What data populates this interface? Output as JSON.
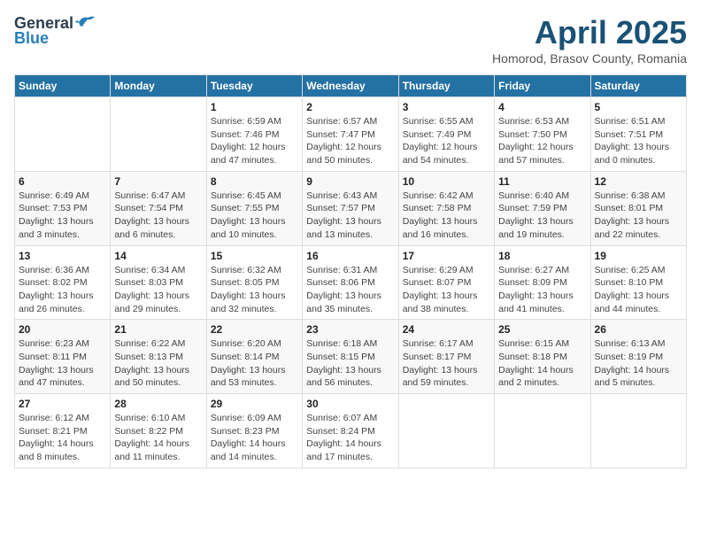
{
  "header": {
    "logo_general": "General",
    "logo_blue": "Blue",
    "month_title": "April 2025",
    "location": "Homorod, Brasov County, Romania"
  },
  "weekdays": [
    "Sunday",
    "Monday",
    "Tuesday",
    "Wednesday",
    "Thursday",
    "Friday",
    "Saturday"
  ],
  "weeks": [
    [
      {
        "day": "",
        "info": ""
      },
      {
        "day": "",
        "info": ""
      },
      {
        "day": "1",
        "info": "Sunrise: 6:59 AM\nSunset: 7:46 PM\nDaylight: 12 hours and 47 minutes."
      },
      {
        "day": "2",
        "info": "Sunrise: 6:57 AM\nSunset: 7:47 PM\nDaylight: 12 hours and 50 minutes."
      },
      {
        "day": "3",
        "info": "Sunrise: 6:55 AM\nSunset: 7:49 PM\nDaylight: 12 hours and 54 minutes."
      },
      {
        "day": "4",
        "info": "Sunrise: 6:53 AM\nSunset: 7:50 PM\nDaylight: 12 hours and 57 minutes."
      },
      {
        "day": "5",
        "info": "Sunrise: 6:51 AM\nSunset: 7:51 PM\nDaylight: 13 hours and 0 minutes."
      }
    ],
    [
      {
        "day": "6",
        "info": "Sunrise: 6:49 AM\nSunset: 7:53 PM\nDaylight: 13 hours and 3 minutes."
      },
      {
        "day": "7",
        "info": "Sunrise: 6:47 AM\nSunset: 7:54 PM\nDaylight: 13 hours and 6 minutes."
      },
      {
        "day": "8",
        "info": "Sunrise: 6:45 AM\nSunset: 7:55 PM\nDaylight: 13 hours and 10 minutes."
      },
      {
        "day": "9",
        "info": "Sunrise: 6:43 AM\nSunset: 7:57 PM\nDaylight: 13 hours and 13 minutes."
      },
      {
        "day": "10",
        "info": "Sunrise: 6:42 AM\nSunset: 7:58 PM\nDaylight: 13 hours and 16 minutes."
      },
      {
        "day": "11",
        "info": "Sunrise: 6:40 AM\nSunset: 7:59 PM\nDaylight: 13 hours and 19 minutes."
      },
      {
        "day": "12",
        "info": "Sunrise: 6:38 AM\nSunset: 8:01 PM\nDaylight: 13 hours and 22 minutes."
      }
    ],
    [
      {
        "day": "13",
        "info": "Sunrise: 6:36 AM\nSunset: 8:02 PM\nDaylight: 13 hours and 26 minutes."
      },
      {
        "day": "14",
        "info": "Sunrise: 6:34 AM\nSunset: 8:03 PM\nDaylight: 13 hours and 29 minutes."
      },
      {
        "day": "15",
        "info": "Sunrise: 6:32 AM\nSunset: 8:05 PM\nDaylight: 13 hours and 32 minutes."
      },
      {
        "day": "16",
        "info": "Sunrise: 6:31 AM\nSunset: 8:06 PM\nDaylight: 13 hours and 35 minutes."
      },
      {
        "day": "17",
        "info": "Sunrise: 6:29 AM\nSunset: 8:07 PM\nDaylight: 13 hours and 38 minutes."
      },
      {
        "day": "18",
        "info": "Sunrise: 6:27 AM\nSunset: 8:09 PM\nDaylight: 13 hours and 41 minutes."
      },
      {
        "day": "19",
        "info": "Sunrise: 6:25 AM\nSunset: 8:10 PM\nDaylight: 13 hours and 44 minutes."
      }
    ],
    [
      {
        "day": "20",
        "info": "Sunrise: 6:23 AM\nSunset: 8:11 PM\nDaylight: 13 hours and 47 minutes."
      },
      {
        "day": "21",
        "info": "Sunrise: 6:22 AM\nSunset: 8:13 PM\nDaylight: 13 hours and 50 minutes."
      },
      {
        "day": "22",
        "info": "Sunrise: 6:20 AM\nSunset: 8:14 PM\nDaylight: 13 hours and 53 minutes."
      },
      {
        "day": "23",
        "info": "Sunrise: 6:18 AM\nSunset: 8:15 PM\nDaylight: 13 hours and 56 minutes."
      },
      {
        "day": "24",
        "info": "Sunrise: 6:17 AM\nSunset: 8:17 PM\nDaylight: 13 hours and 59 minutes."
      },
      {
        "day": "25",
        "info": "Sunrise: 6:15 AM\nSunset: 8:18 PM\nDaylight: 14 hours and 2 minutes."
      },
      {
        "day": "26",
        "info": "Sunrise: 6:13 AM\nSunset: 8:19 PM\nDaylight: 14 hours and 5 minutes."
      }
    ],
    [
      {
        "day": "27",
        "info": "Sunrise: 6:12 AM\nSunset: 8:21 PM\nDaylight: 14 hours and 8 minutes."
      },
      {
        "day": "28",
        "info": "Sunrise: 6:10 AM\nSunset: 8:22 PM\nDaylight: 14 hours and 11 minutes."
      },
      {
        "day": "29",
        "info": "Sunrise: 6:09 AM\nSunset: 8:23 PM\nDaylight: 14 hours and 14 minutes."
      },
      {
        "day": "30",
        "info": "Sunrise: 6:07 AM\nSunset: 8:24 PM\nDaylight: 14 hours and 17 minutes."
      },
      {
        "day": "",
        "info": ""
      },
      {
        "day": "",
        "info": ""
      },
      {
        "day": "",
        "info": ""
      }
    ]
  ]
}
